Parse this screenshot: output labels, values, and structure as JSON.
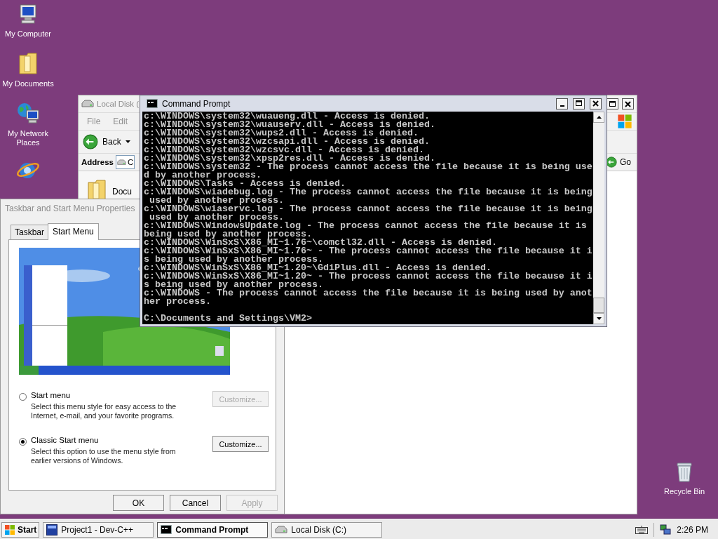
{
  "desktop_icons": [
    {
      "kind": "computer",
      "label": "My Computer"
    },
    {
      "kind": "folder",
      "label": "My Documents"
    },
    {
      "kind": "network",
      "label": "My Network Places"
    },
    {
      "kind": "browser"
    }
  ],
  "recycle_bin": {
    "kind": "trash",
    "label": "Recycle Bin"
  },
  "explorer": {
    "title": "Local Disk (",
    "menu": [
      "File",
      "Edit"
    ],
    "back": "Back",
    "address_label": "Address",
    "address_value": "C",
    "go": "Go",
    "item": "Docu"
  },
  "console": {
    "title": "Command Prompt",
    "lines": [
      "c:\\WINDOWS\\system32\\wuaueng.dll - Access is denied.",
      "c:\\WINDOWS\\system32\\wuauserv.dll - Access is denied.",
      "c:\\WINDOWS\\system32\\wups2.dll - Access is denied.",
      "c:\\WINDOWS\\system32\\wzcsapi.dll - Access is denied.",
      "c:\\WINDOWS\\system32\\wzcsvc.dll - Access is denied.",
      "c:\\WINDOWS\\system32\\xpsp2res.dll - Access is denied.",
      "c:\\WINDOWS\\system32 - The process cannot access the file because it is being use",
      "d by another process.",
      "c:\\WINDOWS\\Tasks - Access is denied.",
      "c:\\WINDOWS\\wiadebug.log - The process cannot access the file because it is being",
      " used by another process.",
      "c:\\WINDOWS\\wiaservc.log - The process cannot access the file because it is being",
      " used by another process.",
      "c:\\WINDOWS\\WindowsUpdate.log - The process cannot access the file because it is",
      "being used by another process.",
      "c:\\WINDOWS\\WinSxS\\X86_MI~1.76~\\comctl32.dll - Access is denied.",
      "c:\\WINDOWS\\WinSxS\\X86_MI~1.76~ - The process cannot access the file because it i",
      "s being used by another process.",
      "c:\\WINDOWS\\WinSxS\\X86_MI~1.20~\\GdiPlus.dll - Access is denied.",
      "c:\\WINDOWS\\WinSxS\\X86_MI~1.20~ - The process cannot access the file because it i",
      "s being used by another process.",
      "c:\\WINDOWS - The process cannot access the file because it is being used by anot",
      "her process."
    ],
    "prompt": "C:\\Documents and Settings\\VM2>"
  },
  "dialog": {
    "title": "Taskbar and Start Menu Properties",
    "tabs": [
      {
        "label": "Taskbar",
        "selected": false
      },
      {
        "label": "Start Menu",
        "selected": true
      }
    ],
    "options": [
      {
        "label": "Start menu",
        "description": "Select this menu style for easy access to the Internet, e-mail, and your favorite programs.",
        "selected": false,
        "customize": {
          "label": "Customize...",
          "disabled": true
        }
      },
      {
        "label": "Classic Start menu",
        "description": "Select this option to use the menu style from earlier versions of Windows.",
        "selected": true,
        "customize": {
          "label": "Customize...",
          "disabled": false
        }
      }
    ],
    "buttons": [
      {
        "label": "OK",
        "disabled": false
      },
      {
        "label": "Cancel",
        "disabled": false
      },
      {
        "label": "Apply",
        "disabled": true
      }
    ]
  },
  "taskbar": {
    "start": "Start",
    "tasks": [
      {
        "kind": "devcpp",
        "label": "Project1 - Dev-C++",
        "selected": false
      },
      {
        "kind": "console",
        "label": "Command Prompt",
        "selected": true
      },
      {
        "kind": "drive",
        "label": "Local Disk (C:)",
        "selected": false
      }
    ],
    "clock": "2:26 PM"
  }
}
